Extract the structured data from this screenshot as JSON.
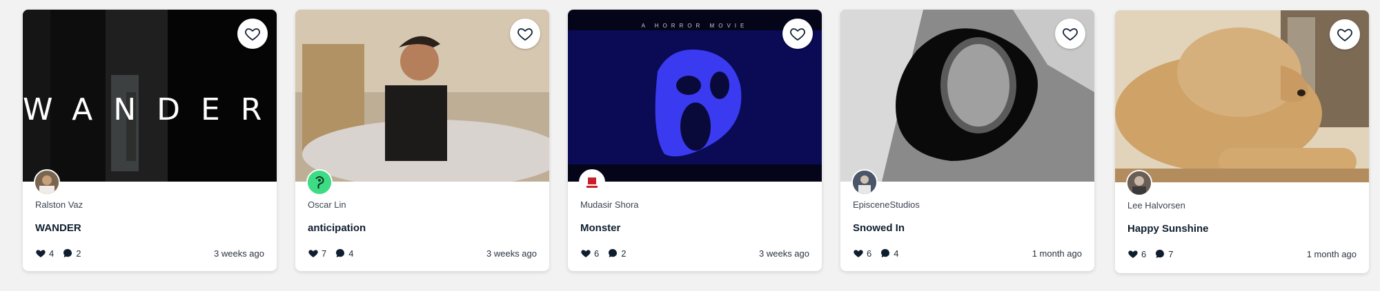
{
  "cards": [
    {
      "author": "Ralston Vaz",
      "title": "WANDER",
      "likes": "4",
      "comments": "2",
      "time": "3 weeks ago",
      "overlay": "WANDER"
    },
    {
      "author": "Oscar Lin",
      "title": "anticipation",
      "likes": "7",
      "comments": "4",
      "time": "3 weeks ago"
    },
    {
      "author": "Mudasir Shora",
      "title": "Monster",
      "likes": "6",
      "comments": "2",
      "time": "3 weeks ago",
      "overlay_small": "A HORROR MOVIE"
    },
    {
      "author": "EpisceneStudios",
      "title": "Snowed In",
      "likes": "6",
      "comments": "4",
      "time": "1 month ago"
    },
    {
      "author": "Lee Halvorsen",
      "title": "Happy Sunshine",
      "likes": "6",
      "comments": "7",
      "time": "1 month ago"
    }
  ],
  "colors": {
    "heart": "#0f1e2e",
    "avatar_green": "#3ddc84"
  },
  "icons": {
    "favorite": "heart-outline-icon",
    "likes": "heart-icon",
    "comments": "comment-icon"
  }
}
